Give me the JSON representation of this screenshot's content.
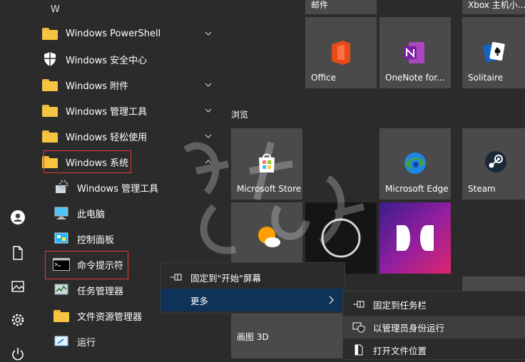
{
  "rail": {
    "icons": [
      "user-icon",
      "document-icon",
      "pictures-icon",
      "settings-icon",
      "power-icon"
    ]
  },
  "applist": {
    "letter": "W",
    "items": [
      {
        "label": "Windows PowerShell",
        "icon": "folder-icon",
        "expandable": true
      },
      {
        "label": "Windows 安全中心",
        "icon": "shield-icon",
        "expandable": false
      },
      {
        "label": "Windows 附件",
        "icon": "folder-icon",
        "expandable": true
      },
      {
        "label": "Windows 管理工具",
        "icon": "folder-icon",
        "expandable": true
      },
      {
        "label": "Windows 轻松使用",
        "icon": "folder-icon",
        "expandable": true
      },
      {
        "label": "Windows 系统",
        "icon": "folder-icon",
        "expandable": true,
        "expanded": true
      }
    ],
    "subitems": [
      {
        "label": "Windows 管理工具",
        "icon": "admin-tools-icon"
      },
      {
        "label": "此电脑",
        "icon": "this-pc-icon"
      },
      {
        "label": "控制面板",
        "icon": "control-panel-icon"
      },
      {
        "label": "命令提示符",
        "icon": "cmd-icon"
      },
      {
        "label": "任务管理器",
        "icon": "task-manager-icon"
      },
      {
        "label": "文件资源管理器",
        "icon": "file-explorer-icon"
      },
      {
        "label": "运行",
        "icon": "run-icon"
      }
    ]
  },
  "tiles": {
    "group_label": "浏览",
    "items": [
      {
        "label": "邮件",
        "icon": ""
      },
      {
        "label": "Xbox 主机小...",
        "icon": ""
      },
      {
        "label": "Office",
        "icon": "office-icon"
      },
      {
        "label": "OneNote for...",
        "icon": "onenote-icon"
      },
      {
        "label": "Solitaire",
        "icon": "solitaire-icon"
      },
      {
        "label": "Microsoft Store",
        "icon": "store-icon"
      },
      {
        "label": "Microsoft Edge",
        "icon": "edge-icon"
      },
      {
        "label": "Steam",
        "icon": "steam-icon"
      },
      {
        "label": "",
        "icon": "weather-icon"
      },
      {
        "label": "",
        "icon": "ring-icon"
      },
      {
        "label": "",
        "icon": "dolby-icon"
      },
      {
        "label": "画图 3D",
        "icon": ""
      }
    ]
  },
  "context_menu": {
    "items": [
      {
        "label": "固定到\"开始\"屏幕",
        "icon": "pin-icon"
      },
      {
        "label": "更多",
        "icon": ""
      }
    ]
  },
  "submenu": {
    "items": [
      {
        "label": "固定到任务栏",
        "icon": "pin-icon"
      },
      {
        "label": "以管理员身份运行",
        "icon": "shield-admin-icon"
      },
      {
        "label": "打开文件位置",
        "icon": "folder-open-icon"
      }
    ]
  },
  "colors": {
    "accent_selected": "#0f3358",
    "highlight_box": "#e53935",
    "background": "#2b2b2b",
    "tile": "#4a4a4a"
  }
}
